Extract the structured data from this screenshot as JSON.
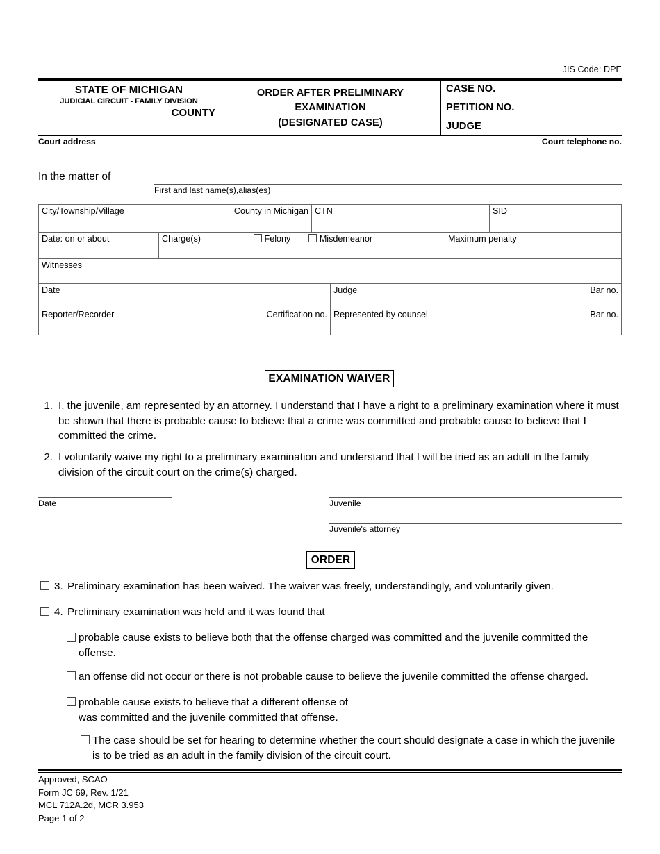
{
  "jis_code": "JIS Code: DPE",
  "caption": {
    "state": "STATE OF MICHIGAN",
    "circuit": "JUDICIAL CIRCUIT - FAMILY DIVISION",
    "county": "COUNTY",
    "title_line1": "ORDER AFTER PRELIMINARY",
    "title_line2": "EXAMINATION",
    "title_line3": "(DESIGNATED CASE)",
    "case_no": "CASE NO.",
    "petition_no": "PETITION NO.",
    "judge": "JUDGE"
  },
  "address_row": {
    "court_address": "Court address",
    "court_telephone": "Court telephone no."
  },
  "matter": {
    "label": "In the matter of",
    "sublabel": "First and last name(s),alias(es)"
  },
  "info_grid": {
    "row1": {
      "city_township_village": "City/Township/Village",
      "county_in_michigan": "County in Michigan",
      "ctn": "CTN",
      "sid": "SID"
    },
    "row2": {
      "date_on_or_about": "Date: on or about",
      "charges": "Charge(s)",
      "felony": "Felony",
      "misdemeanor": "Misdemeanor",
      "maximum_penalty": "Maximum penalty"
    },
    "row3": {
      "witnesses": "Witnesses"
    },
    "row4": {
      "date": "Date",
      "judge": "Judge",
      "bar_no": "Bar no."
    },
    "row5": {
      "reporter_recorder": "Reporter/Recorder",
      "certification_no": "Certification no.",
      "represented_by_counsel": "Represented by counsel",
      "bar_no": "Bar no."
    }
  },
  "examination_waiver": {
    "heading": "EXAMINATION WAIVER",
    "items": [
      {
        "number": "1.",
        "text": "I, the juvenile, am represented by an attorney. I understand that I have a right to a preliminary examination where it must be shown that there is probable cause to believe that a crime was committed and probable cause to believe that I committed the crime."
      },
      {
        "number": "2.",
        "text": "I voluntarily waive my right to a preliminary examination and understand that I will be tried as an adult in the family division of the circuit court on the crime(s) charged."
      }
    ]
  },
  "signatures": {
    "date_label": "Date",
    "juvenile_label": "Juvenile",
    "juvenile_attorney_label": "Juvenile's attorney"
  },
  "order": {
    "heading": "ORDER",
    "item3": {
      "number": "3.",
      "text": "Preliminary examination has been waived. The waiver was freely, understandingly, and voluntarily given."
    },
    "item4": {
      "number": "4.",
      "text": "Preliminary examination was held and it was found that"
    },
    "sub_a": "probable cause exists to believe both that the offense charged was committed and the juvenile committed the offense.",
    "sub_b": "an offense did not occur or there is not probable cause to believe the juvenile committed the offense charged.",
    "sub_c_part1": "probable cause exists to believe that a different offense of",
    "sub_c_part2": "was committed and the juvenile committed that offense.",
    "sub_d": "The case should be set for hearing to determine whether the court should designate a case in which the juvenile is to be tried as an adult in the family division of the circuit court."
  },
  "footer": {
    "line1": "Approved, SCAO",
    "line2": "Form JC 69, Rev. 1/21",
    "line3": "MCL 712A.2d, MCR 3.953",
    "line4": "Page 1 of 2"
  }
}
